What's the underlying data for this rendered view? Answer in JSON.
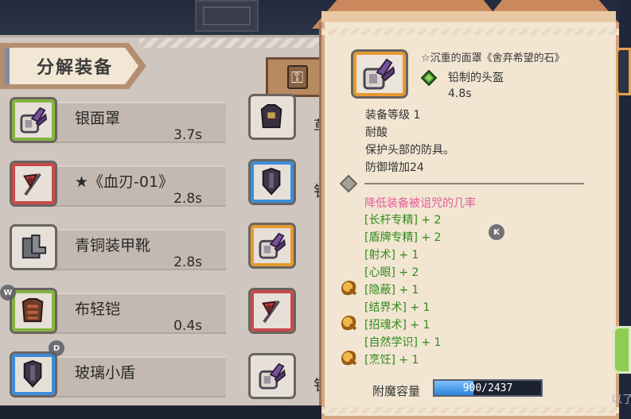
{
  "panel": {
    "title": "分解装备"
  },
  "items": [
    {
      "name": "银面罩",
      "time": "3.7s",
      "rarity": "green",
      "icon": "helmet-mask-icon"
    },
    {
      "name": "★《血刃-01》",
      "time": "2.8s",
      "rarity": "red",
      "icon": "axe-icon"
    },
    {
      "name": "青铜装甲靴",
      "time": "2.8s",
      "rarity": "plain",
      "icon": "boots-icon"
    },
    {
      "name": "布轻铠",
      "time": "0.4s",
      "rarity": "green",
      "icon": "chest-armor-icon"
    },
    {
      "name": "玻璃小盾",
      "time": "",
      "rarity": "blue",
      "icon": "shield-icon"
    }
  ],
  "right_column": [
    {
      "icon": "armor-icon",
      "text": "草",
      "rarity": "plain"
    },
    {
      "icon": "shield-icon",
      "text": "钅",
      "rarity": "blue"
    },
    {
      "icon": "helmet-mask-icon",
      "text": "",
      "rarity": "orange"
    },
    {
      "icon": "axe-icon",
      "text": "",
      "rarity": "red"
    },
    {
      "icon": "helmet-mask-icon",
      "text": "钅",
      "rarity": "plain"
    }
  ],
  "keys": {
    "w": "W",
    "d": "D",
    "k": "K"
  },
  "tooltip": {
    "title": "☆沉重的面罩《舍弃希望的石》",
    "type": "铅制的头盔",
    "time": "4.8s",
    "level": "装备等级 1",
    "trait": "耐酸",
    "description": "保护头部的防具。",
    "defense": "防御增加24",
    "curse": "降低装备被诅咒的几率",
    "bonuses": [
      "[长杆专精] + 2",
      "[盾牌专精] + 2",
      "[射术] + 1",
      "[心眼] + 2",
      "[隐蔽] + 1",
      "[结界术] + 1",
      "[招魂术] + 1",
      "[自然学识] + 1",
      "[烹饪] + 1"
    ],
    "enchant_label": "附魔容量",
    "enchant_value": "900/2437",
    "enchant_fraction": 0.369
  },
  "right_strip": {
    "bottom_text": "以了"
  },
  "colors": {
    "bonus": "#2f8c1b",
    "curse": "#e25b9d",
    "panel": "#cfc6bf",
    "tooltip": "#f2e5d2"
  }
}
